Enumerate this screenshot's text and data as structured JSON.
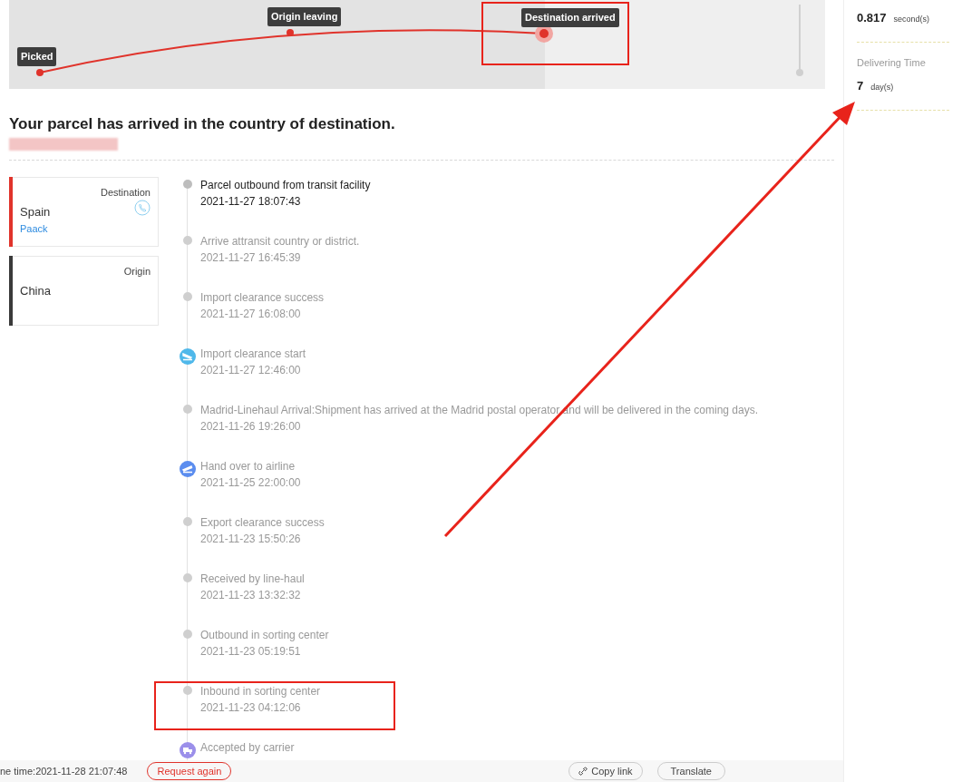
{
  "route_map": {
    "stops": [
      {
        "label": "Picked",
        "current": false
      },
      {
        "label": "Origin leaving",
        "current": false
      },
      {
        "label": "Destination arrived",
        "current": true
      }
    ]
  },
  "status_title": "Your parcel has arrived in the country of destination.",
  "places": [
    {
      "kind": "destination",
      "caption": "Destination",
      "country": "Spain",
      "carrier": "Paack",
      "color": "#e0332b"
    },
    {
      "kind": "origin",
      "caption": "Origin",
      "country": "China",
      "color": "#3a3a3a"
    }
  ],
  "events": [
    {
      "kind": "dot",
      "title": "Parcel outbound from transit facility",
      "time": "2021-11-27 18:07:43",
      "latest": true
    },
    {
      "kind": "dot",
      "title": "Arrive attransit country or district.",
      "time": "2021-11-27 16:45:39",
      "latest": false
    },
    {
      "kind": "dot",
      "title": "Import clearance success",
      "time": "2021-11-27 16:08:00",
      "latest": false
    },
    {
      "kind": "landing",
      "title": "Import clearance start",
      "time": "2021-11-27 12:46:00",
      "latest": false
    },
    {
      "kind": "dot",
      "title": "Madrid-Linehaul Arrival:Shipment has arrived at the Madrid postal operator and will be delivered in the coming days.",
      "time": "2021-11-26 19:26:00",
      "latest": false
    },
    {
      "kind": "takeoff",
      "title": "Hand over to airline",
      "time": "2021-11-25 22:00:00",
      "latest": false
    },
    {
      "kind": "dot",
      "title": "Export clearance success",
      "time": "2021-11-23 15:50:26",
      "latest": false
    },
    {
      "kind": "dot",
      "title": "Received by line-haul",
      "time": "2021-11-23 13:32:32",
      "latest": false
    },
    {
      "kind": "dot",
      "title": "Outbound in sorting center",
      "time": "2021-11-23 05:19:51",
      "latest": false
    },
    {
      "kind": "dot",
      "title": "Inbound in sorting center",
      "time": "2021-11-23 04:12:06",
      "latest": false
    },
    {
      "kind": "truck",
      "title": "Accepted by carrier",
      "latest": false
    }
  ],
  "footer": {
    "query_time": "ne time:2021-11-28 21:07:48",
    "request_button": "Request again",
    "copy_button": "Copy link",
    "translate_button": "Translate"
  },
  "stats": [
    {
      "value": "0.817",
      "unit": "second(s)"
    },
    {
      "label": "Delivering Time",
      "value": "7",
      "unit": "day(s)"
    }
  ]
}
